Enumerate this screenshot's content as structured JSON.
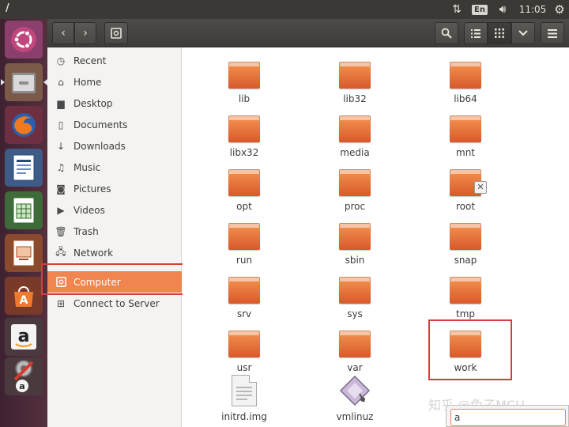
{
  "window": {
    "title": "/"
  },
  "top_panel": {
    "network_icon": "network-updown-icon",
    "keyboard_layout": "En",
    "volume_icon": "volume-icon",
    "clock": "11:05",
    "settings_icon": "gear-icon"
  },
  "launcher": {
    "items": [
      {
        "name": "ubuntu-dash",
        "icon": "ubuntu-logo-icon"
      },
      {
        "name": "files",
        "icon": "file-manager-icon",
        "active": true
      },
      {
        "name": "firefox",
        "icon": "firefox-icon"
      },
      {
        "name": "libreoffice-writer",
        "icon": "writer-icon"
      },
      {
        "name": "libreoffice-calc",
        "icon": "calc-icon"
      },
      {
        "name": "libreoffice-impress",
        "icon": "impress-icon"
      },
      {
        "name": "ubuntu-software",
        "icon": "software-center-icon"
      },
      {
        "name": "amazon",
        "icon": "amazon-icon"
      },
      {
        "name": "system-settings",
        "icon": "settings-tools-icon"
      }
    ]
  },
  "headerbar": {
    "back_icon": "chevron-left-icon",
    "forward_icon": "chevron-right-icon",
    "location_icon": "drive-icon",
    "search_icon": "search-icon",
    "list_view_icon": "list-view-icon",
    "grid_view_icon": "grid-view-icon",
    "view_options_icon": "chevron-down-icon",
    "menu_icon": "hamburger-menu-icon"
  },
  "sidebar": {
    "items": [
      {
        "label": "Recent",
        "icon": "clock-icon"
      },
      {
        "label": "Home",
        "icon": "home-icon"
      },
      {
        "label": "Desktop",
        "icon": "folder-icon"
      },
      {
        "label": "Documents",
        "icon": "document-icon"
      },
      {
        "label": "Downloads",
        "icon": "download-icon"
      },
      {
        "label": "Music",
        "icon": "music-icon"
      },
      {
        "label": "Pictures",
        "icon": "camera-icon"
      },
      {
        "label": "Videos",
        "icon": "video-icon"
      },
      {
        "label": "Trash",
        "icon": "trash-icon"
      },
      {
        "label": "Network",
        "icon": "network-icon"
      },
      {
        "label": "Computer",
        "icon": "drive-icon",
        "selected": true
      },
      {
        "label": "Connect to Server",
        "icon": "connect-server-icon"
      }
    ]
  },
  "files": [
    {
      "name": "lib",
      "type": "folder"
    },
    {
      "name": "lib32",
      "type": "folder"
    },
    {
      "name": "lib64",
      "type": "folder"
    },
    {
      "name": "libx32",
      "type": "folder"
    },
    {
      "name": "media",
      "type": "folder"
    },
    {
      "name": "mnt",
      "type": "folder"
    },
    {
      "name": "opt",
      "type": "folder"
    },
    {
      "name": "proc",
      "type": "folder"
    },
    {
      "name": "root",
      "type": "folder",
      "emblem": "locked-x-icon"
    },
    {
      "name": "run",
      "type": "folder"
    },
    {
      "name": "sbin",
      "type": "folder"
    },
    {
      "name": "snap",
      "type": "folder"
    },
    {
      "name": "srv",
      "type": "folder"
    },
    {
      "name": "sys",
      "type": "folder"
    },
    {
      "name": "tmp",
      "type": "folder"
    },
    {
      "name": "usr",
      "type": "folder"
    },
    {
      "name": "var",
      "type": "folder"
    },
    {
      "name": "work",
      "type": "folder",
      "highlighted": true
    },
    {
      "name": "initrd.img",
      "type": "document"
    },
    {
      "name": "vmlinuz",
      "type": "kernel"
    }
  ],
  "type_ahead": {
    "value": "a"
  },
  "watermark": "知乎 @兔子MCU",
  "colors": {
    "accent": "#f0854f",
    "annotation_red": "#d33f3f",
    "panel": "#3a3936",
    "launcher": "#4a2a3b"
  }
}
